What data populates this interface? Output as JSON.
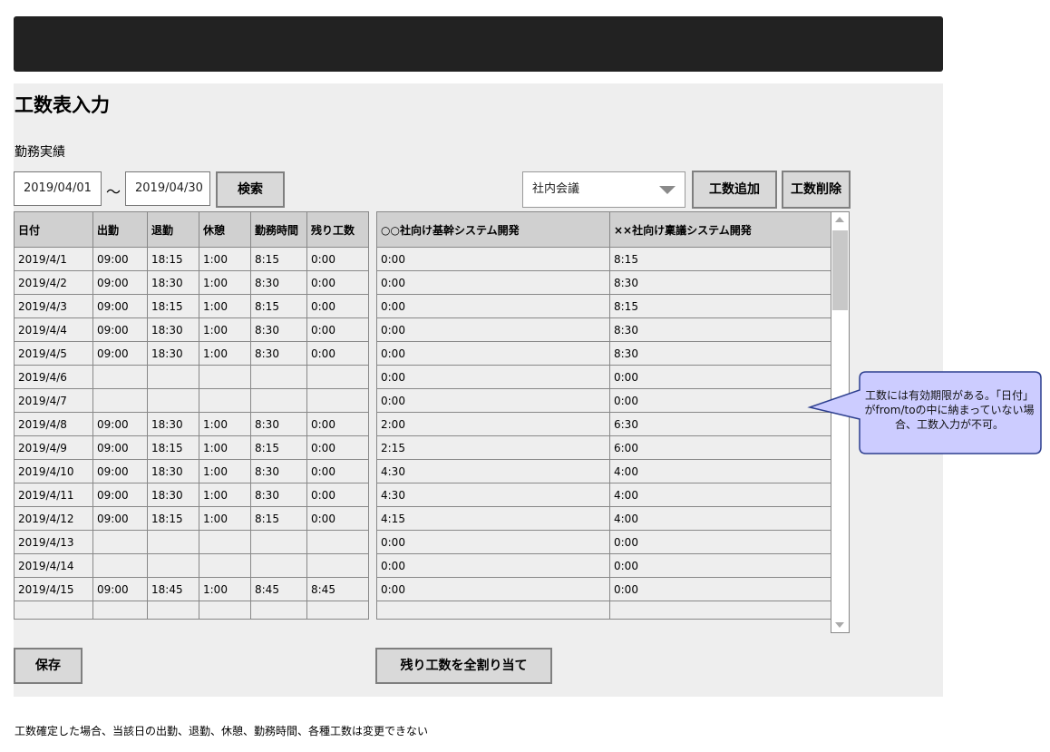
{
  "page": {
    "title": "工数表入力",
    "subtitle": "勤務実績",
    "footer_note": "工数確定した場合、当該日の出勤、退勤、休憩、勤務時間、各種工数は変更できない"
  },
  "filter": {
    "date_from": "2019/04/01",
    "separator": "～",
    "date_to": "2019/04/30",
    "search_label": "検索"
  },
  "project_select": {
    "selected": "社内会議"
  },
  "buttons": {
    "add_label": "工数追加",
    "delete_label": "工数削除",
    "save_label": "保存",
    "assign_label": "残り工数を全割り当て"
  },
  "attendance_table": {
    "headers": [
      "日付",
      "出勤",
      "退勤",
      "休憩",
      "勤務時間",
      "残り工数"
    ],
    "rows": [
      [
        "2019/4/1",
        "09:00",
        "18:15",
        "1:00",
        "8:15",
        "0:00"
      ],
      [
        "2019/4/2",
        "09:00",
        "18:30",
        "1:00",
        "8:30",
        "0:00"
      ],
      [
        "2019/4/3",
        "09:00",
        "18:15",
        "1:00",
        "8:15",
        "0:00"
      ],
      [
        "2019/4/4",
        "09:00",
        "18:30",
        "1:00",
        "8:30",
        "0:00"
      ],
      [
        "2019/4/5",
        "09:00",
        "18:30",
        "1:00",
        "8:30",
        "0:00"
      ],
      [
        "2019/4/6",
        "",
        "",
        "",
        "",
        ""
      ],
      [
        "2019/4/7",
        "",
        "",
        "",
        "",
        ""
      ],
      [
        "2019/4/8",
        "09:00",
        "18:30",
        "1:00",
        "8:30",
        "0:00"
      ],
      [
        "2019/4/9",
        "09:00",
        "18:15",
        "1:00",
        "8:15",
        "0:00"
      ],
      [
        "2019/4/10",
        "09:00",
        "18:30",
        "1:00",
        "8:30",
        "0:00"
      ],
      [
        "2019/4/11",
        "09:00",
        "18:30",
        "1:00",
        "8:30",
        "0:00"
      ],
      [
        "2019/4/12",
        "09:00",
        "18:15",
        "1:00",
        "8:15",
        "0:00"
      ],
      [
        "2019/4/13",
        "",
        "",
        "",
        "",
        ""
      ],
      [
        "2019/4/14",
        "",
        "",
        "",
        "",
        ""
      ],
      [
        "2019/4/15",
        "09:00",
        "18:45",
        "1:00",
        "8:45",
        "8:45"
      ],
      [
        "",
        "",
        "",
        "",
        "",
        ""
      ]
    ]
  },
  "project_table": {
    "headers": [
      "○○社向け基幹システム開発",
      "××社向け稟議システム開発"
    ],
    "rows": [
      [
        "0:00",
        "8:15"
      ],
      [
        "0:00",
        "8:30"
      ],
      [
        "0:00",
        "8:15"
      ],
      [
        "0:00",
        "8:30"
      ],
      [
        "0:00",
        "8:30"
      ],
      [
        "0:00",
        "0:00"
      ],
      [
        "0:00",
        "0:00"
      ],
      [
        "2:00",
        "6:30"
      ],
      [
        "2:15",
        "6:00"
      ],
      [
        "4:30",
        "4:00"
      ],
      [
        "4:30",
        "4:00"
      ],
      [
        "4:15",
        "4:00"
      ],
      [
        "0:00",
        "0:00"
      ],
      [
        "0:00",
        "0:00"
      ],
      [
        "0:00",
        "0:00"
      ],
      [
        "",
        ""
      ]
    ]
  },
  "callout": {
    "text": "工数には有効期限がある。「日付」がfrom/toの中に納まっていない場合、工数入力が不可。",
    "fill": "#ccccff",
    "stroke": "#2d3f8f"
  }
}
